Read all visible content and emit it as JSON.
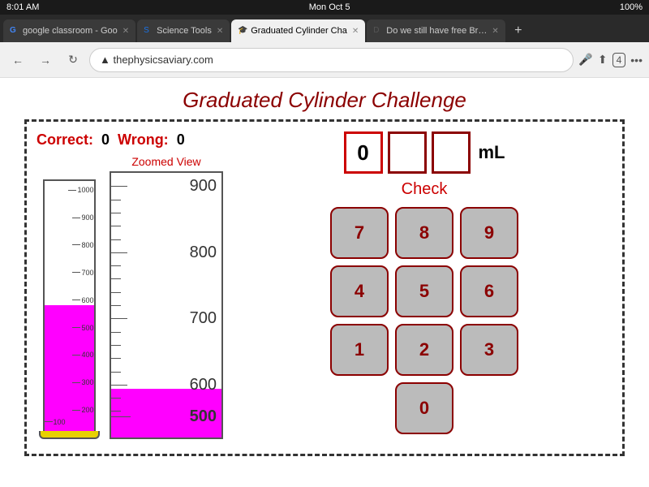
{
  "status_bar": {
    "time": "8:01 AM",
    "day": "Mon Oct 5",
    "battery": "100%",
    "signal": "WiFi"
  },
  "tabs": [
    {
      "id": "tab1",
      "label": "google classroom - Goo",
      "active": false,
      "favicon": "G"
    },
    {
      "id": "tab2",
      "label": "Science Tools",
      "active": false,
      "favicon": "S"
    },
    {
      "id": "tab3",
      "label": "Graduated Cylinder Cha",
      "active": true,
      "favicon": "G"
    },
    {
      "id": "tab4",
      "label": "Do we still have free Br…",
      "active": false,
      "favicon": "D"
    }
  ],
  "address_bar": {
    "url": "▲ thephysicsaviary.com"
  },
  "page": {
    "title": "Graduated Cylinder Challenge",
    "correct_label": "Correct:",
    "correct_value": "0",
    "wrong_label": "Wrong:",
    "wrong_value": "0",
    "zoomed_label": "Zoomed View",
    "ml_label": "mL",
    "check_label": "Check",
    "main_cylinder": {
      "ticks": [
        {
          "value": 1000,
          "pct": 2
        },
        {
          "value": 900,
          "pct": 13
        },
        {
          "value": 800,
          "pct": 24
        },
        {
          "value": 700,
          "pct": 35
        },
        {
          "value": 600,
          "pct": 46
        },
        {
          "value": 500,
          "pct": 57
        },
        {
          "value": 400,
          "pct": 68
        },
        {
          "value": 300,
          "pct": 79
        },
        {
          "value": 200,
          "pct": 90
        },
        {
          "value": 100,
          "pct": 100
        }
      ],
      "liquid_height_pct": 50
    },
    "zoomed_cylinder": {
      "ticks": [
        {
          "value": 900,
          "pct": 8
        },
        {
          "value": 800,
          "pct": 29
        },
        {
          "value": 700,
          "pct": 57
        },
        {
          "value": 600,
          "pct": 78
        }
      ],
      "liquid_height_pct": 18
    },
    "answer": {
      "digits": [
        "0",
        "",
        ""
      ],
      "active_index": 0
    },
    "keypad": {
      "buttons": [
        {
          "label": "7",
          "row": 1,
          "col": 1
        },
        {
          "label": "8",
          "row": 1,
          "col": 2
        },
        {
          "label": "9",
          "row": 1,
          "col": 3
        },
        {
          "label": "4",
          "row": 2,
          "col": 1
        },
        {
          "label": "5",
          "row": 2,
          "col": 2
        },
        {
          "label": "6",
          "row": 2,
          "col": 3
        },
        {
          "label": "1",
          "row": 3,
          "col": 1
        },
        {
          "label": "2",
          "row": 3,
          "col": 2
        },
        {
          "label": "3",
          "row": 3,
          "col": 3
        },
        {
          "label": "0",
          "row": 4,
          "col": 2
        }
      ]
    }
  }
}
